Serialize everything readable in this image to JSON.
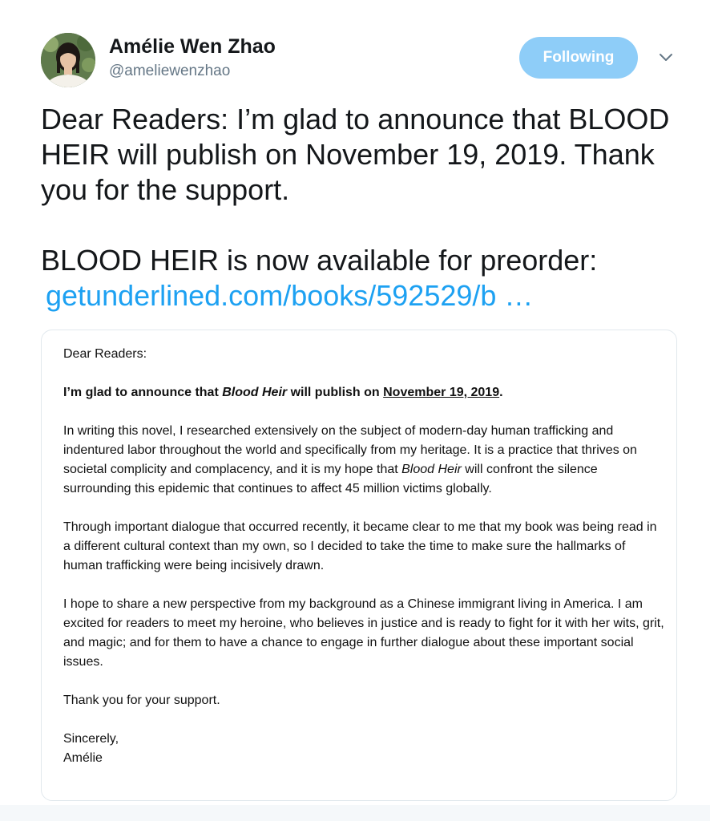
{
  "author": {
    "name": "Amélie Wen Zhao",
    "handle": "@ameliewenzhao"
  },
  "follow_button": {
    "label": "Following",
    "color": "#8ecdf8"
  },
  "caret": {
    "icon": "chevron-down-icon"
  },
  "tweet": {
    "line1": "Dear Readers: I’m glad to announce that BLOOD HEIR will publish on November 19, 2019. Thank you for the support.",
    "line2": "BLOOD HEIR is now available for preorder:",
    "link": "getunderlined.com/books/592529/b …",
    "link_color": "#1da1f2"
  },
  "letter": {
    "salutation": "Dear Readers:",
    "announce_a": "I’m glad to announce that ",
    "announce_title": "Blood Heir",
    "announce_b": " will publish on ",
    "announce_date": "November 19, 2019",
    "announce_c": ".",
    "p1_a": "In writing this novel, I researched extensively on the subject of modern-day human trafficking and indentured labor throughout the world and specifically from my heritage. It is a practice that thrives on societal complicity and complacency, and it is my hope that ",
    "p1_title": "Blood Heir",
    "p1_b": " will confront the silence surrounding this epidemic that continues to affect 45 million victims globally.",
    "p2": "Through important dialogue that occurred recently, it became clear to me that my book was being read in a different cultural context than my own, so I decided to take the time to make sure the hallmarks of human trafficking were being incisively drawn.",
    "p3": "I hope to share a new perspective from my background as a Chinese immigrant living in America. I am excited for readers to meet my heroine, who believes in justice and is ready to fight for it with her wits, grit, and magic; and for them to have a chance to engage in further dialogue about these important social issues.",
    "thanks": "Thank you for your support.",
    "closing": "Sincerely,",
    "signature": "Amélie"
  }
}
